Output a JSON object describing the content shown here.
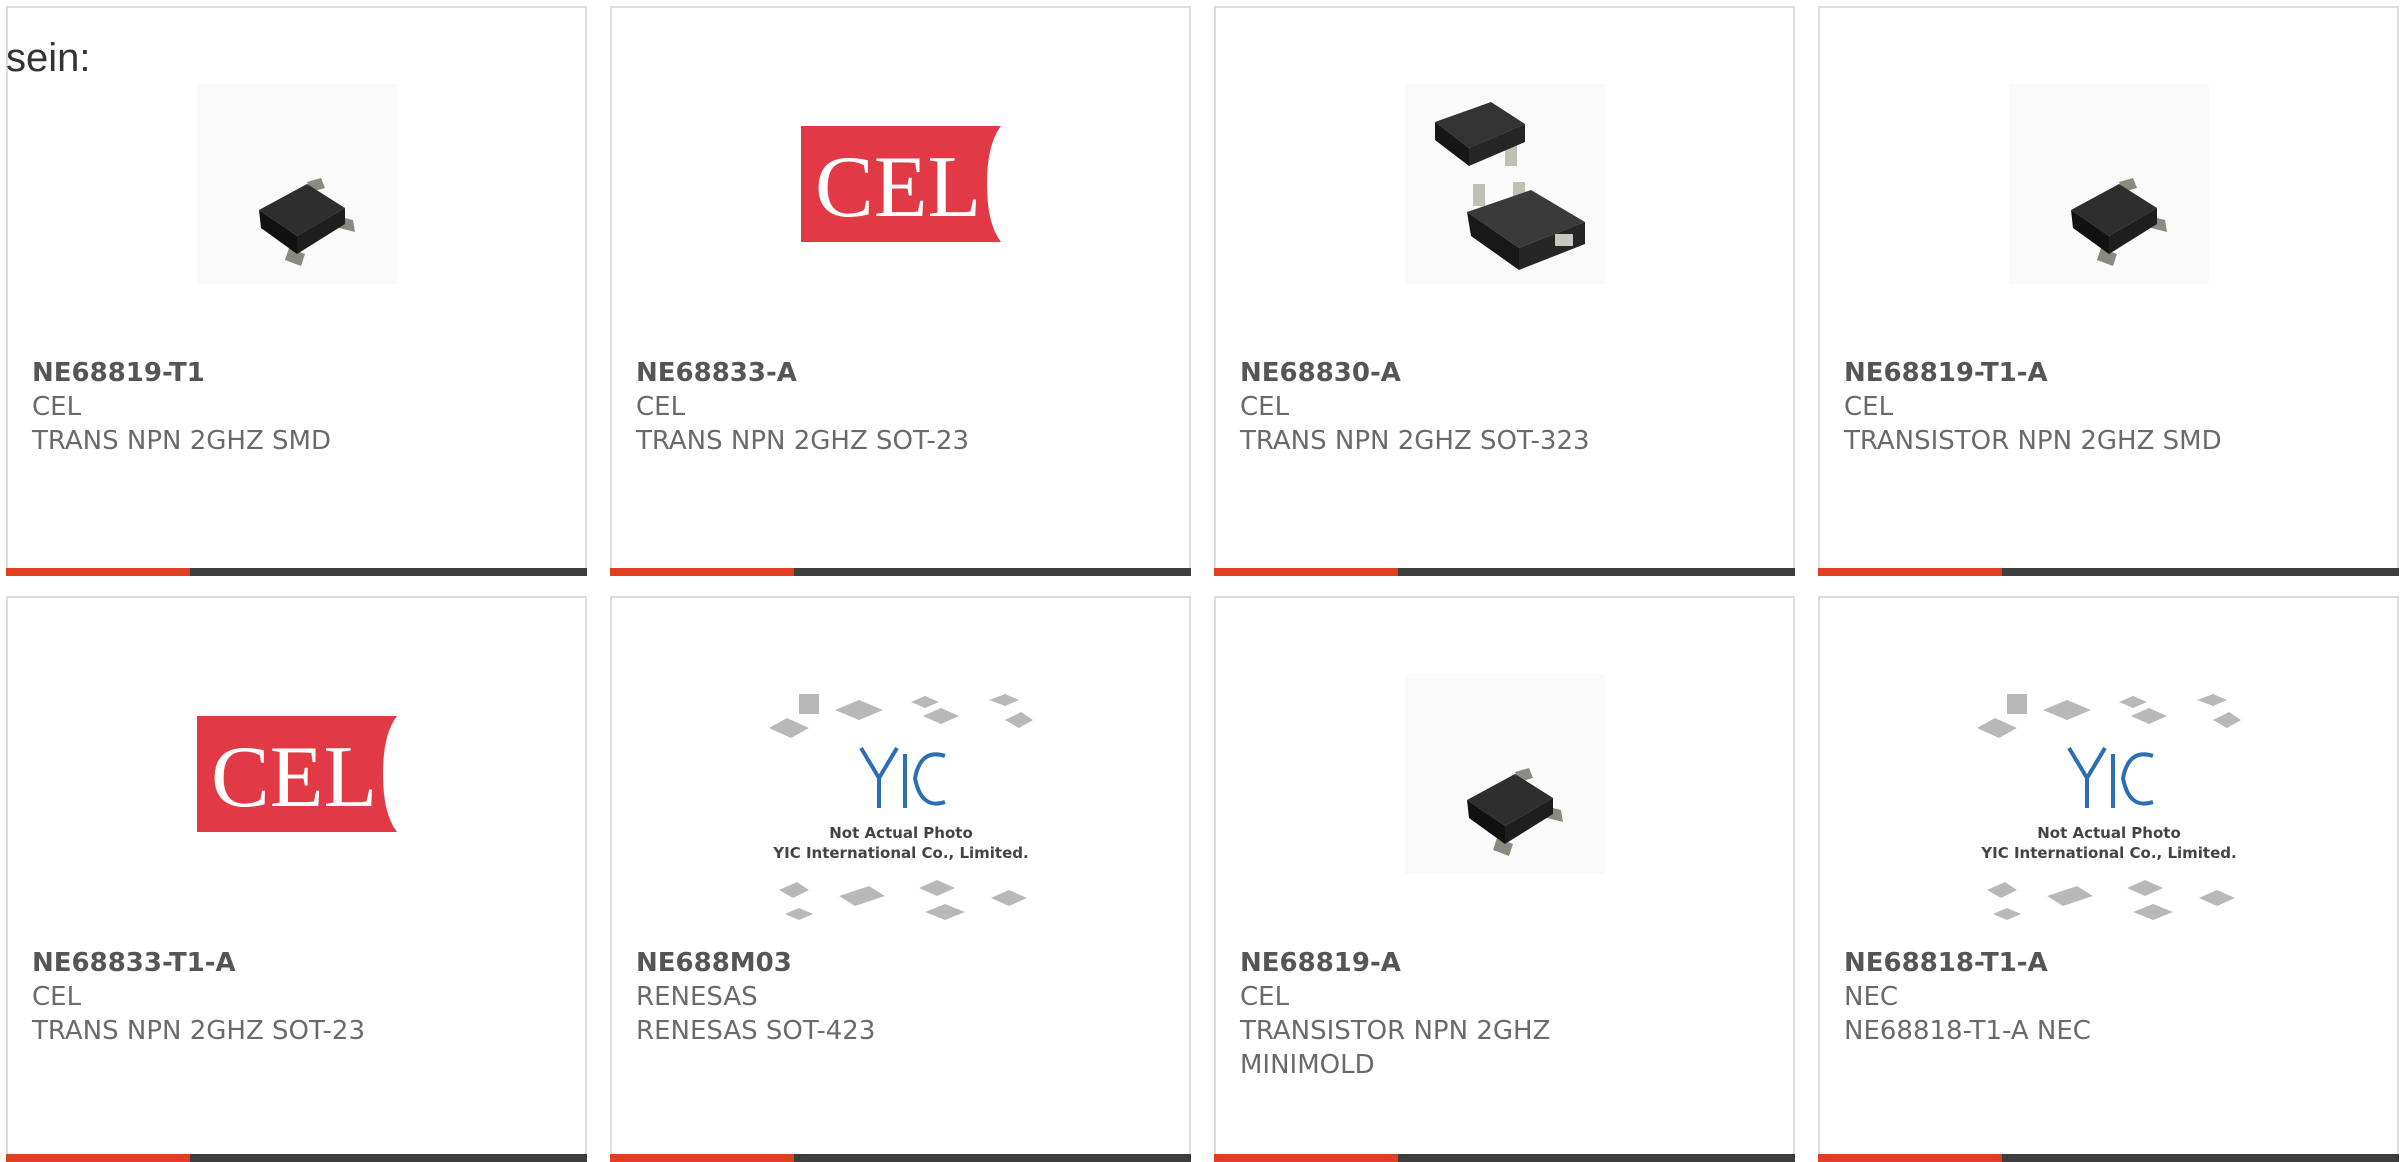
{
  "header": {
    "label": "sein:"
  },
  "products": [
    {
      "part_no": "NE68819-T1",
      "manufacturer": "CEL",
      "description": "TRANS NPN 2GHZ SMD",
      "image": "transistor-sot-photo-icon"
    },
    {
      "part_no": "NE68833-A",
      "manufacturer": "CEL",
      "description": "TRANS NPN 2GHZ SOT-23",
      "image": "cel-logo",
      "logo_text": "CEL"
    },
    {
      "part_no": "NE68830-A",
      "manufacturer": "CEL",
      "description": "TRANS NPN 2GHZ SOT-323",
      "image": "transistor-pair-photo-icon"
    },
    {
      "part_no": "NE68819-T1-A",
      "manufacturer": "CEL",
      "description": "TRANSISTOR NPN 2GHZ SMD",
      "image": "transistor-sot-photo-icon"
    },
    {
      "part_no": "NE68833-T1-A",
      "manufacturer": "CEL",
      "description": "TRANS NPN 2GHZ SOT-23",
      "image": "cel-logo",
      "logo_text": "CEL"
    },
    {
      "part_no": "NE688M03",
      "manufacturer": "RENESAS",
      "description": "RENESAS SOT-423",
      "image": "yic-placeholder",
      "placeholder_lines": [
        "Not Actual Photo",
        "YIC International Co., Limited."
      ],
      "logo_text": "YIC"
    },
    {
      "part_no": "NE68819-A",
      "manufacturer": "CEL",
      "description": "TRANSISTOR NPN 2GHZ MINIMOLD",
      "image": "transistor-sot-photo-icon"
    },
    {
      "part_no": "NE68818-T1-A",
      "manufacturer": "NEC",
      "description": "NE68818-T1-A NEC",
      "image": "yic-placeholder",
      "placeholder_lines": [
        "Not Actual Photo",
        "YIC International Co., Limited."
      ],
      "logo_text": "YIC"
    }
  ],
  "colors": {
    "accent": "#e0401f",
    "bar": "#3d3d3d",
    "cel_red": "#e13a46",
    "yic_blue": "#2a6fb5"
  }
}
